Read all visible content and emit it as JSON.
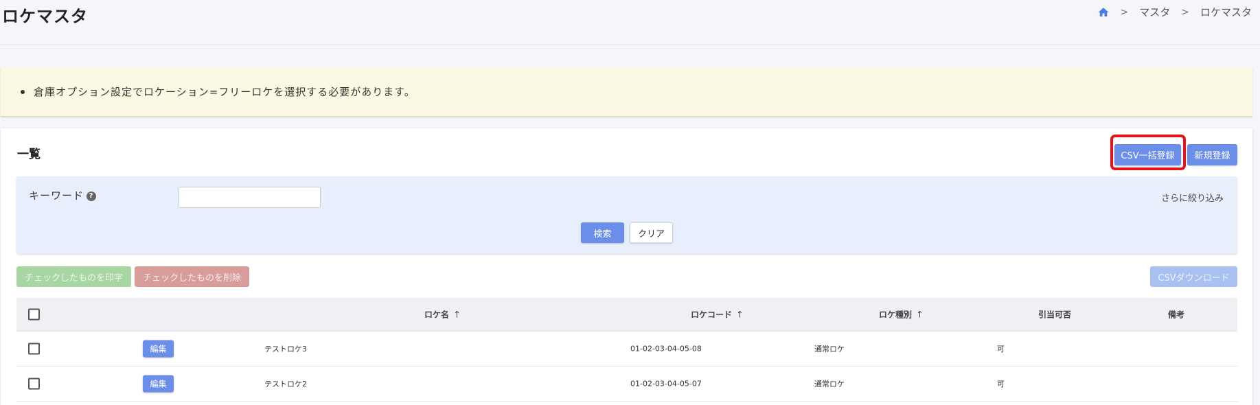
{
  "page": {
    "title": "ロケマスタ",
    "breadcrumb": [
      "マスタ",
      "ロケマスタ"
    ]
  },
  "notice": {
    "message": "倉庫オプション設定でロケーション=フリーロケを選択する必要があります。"
  },
  "list": {
    "title": "一覧",
    "csv_upload_label": "CSV一括登録",
    "new_label": "新規登録"
  },
  "search": {
    "keyword_label": "キーワード",
    "keyword_value": "",
    "keyword_placeholder": "",
    "more_filters_label": "さらに絞り込み",
    "search_label": "検索",
    "clear_label": "クリア"
  },
  "actions": {
    "print_checked_label": "チェックしたものを印字",
    "delete_checked_label": "チェックしたものを削除",
    "csv_download_label": "CSVダウンロード"
  },
  "table": {
    "columns": {
      "loc_name": "ロケ名",
      "loc_code": "ロケコード",
      "loc_type": "ロケ種別",
      "allocatable": "引当可否",
      "remarks": "備考"
    },
    "edit_label": "編集",
    "rows": [
      {
        "loc_name": "テストロケ3",
        "loc_code": "01-02-03-04-05-08",
        "loc_type": "通常ロケ",
        "allocatable": "可",
        "remarks": ""
      },
      {
        "loc_name": "テストロケ2",
        "loc_code": "01-02-03-04-05-07",
        "loc_type": "通常ロケ",
        "allocatable": "可",
        "remarks": ""
      }
    ]
  },
  "colors": {
    "primary": "#6b8ee8",
    "notice_bg": "#fbf9e3",
    "highlight": "#e8121a"
  }
}
